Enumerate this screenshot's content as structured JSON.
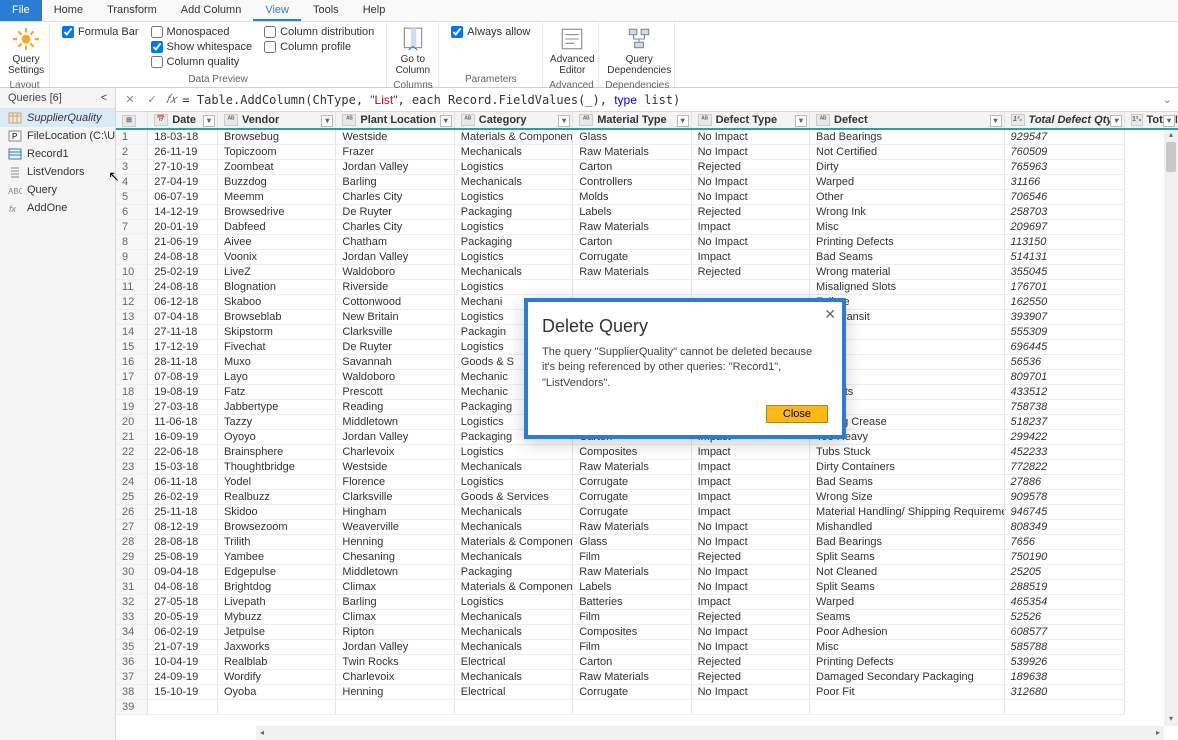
{
  "menubar": [
    "File",
    "Home",
    "Transform",
    "Add Column",
    "View",
    "Tools",
    "Help"
  ],
  "active_menu": "View",
  "ribbon": {
    "layout": {
      "query_settings": "Query\nSettings",
      "label": "Layout"
    },
    "data_preview": {
      "formula_bar": "Formula Bar",
      "monospaced": "Monospaced",
      "show_whitespace": "Show whitespace",
      "column_quality": "Column quality",
      "column_distribution": "Column distribution",
      "column_profile": "Column profile",
      "label": "Data Preview"
    },
    "goto": "Go to\nColumn",
    "columns_label": "Columns",
    "always_allow": "Always allow",
    "parameters_label": "Parameters",
    "adv_editor": "Advanced\nEditor",
    "advanced_label": "Advanced",
    "query_deps": "Query\nDependencies",
    "deps_label": "Dependencies"
  },
  "sidebar": {
    "title": "Queries [6]",
    "items": [
      {
        "name": "SupplierQuality",
        "icon": "table",
        "sel": true
      },
      {
        "name": "FileLocation (C:\\Users...",
        "icon": "param"
      },
      {
        "name": "Record1",
        "icon": "record"
      },
      {
        "name": "ListVendors",
        "icon": "list"
      },
      {
        "name": "Query",
        "icon": "abc"
      },
      {
        "name": "AddOne",
        "icon": "fx"
      }
    ]
  },
  "formula": {
    "prefix": "= Table.AddColumn(ChType, ",
    "str1": "\"List\"",
    "mid1": ", each Record.FieldValues(_), ",
    "kw": "type",
    "mid2": " list)"
  },
  "columns": [
    "",
    "Date",
    "Vendor",
    "Plant Location",
    "Category",
    "Material Type",
    "Defect Type",
    "Defect",
    "Total Defect Qty",
    "Total Dow"
  ],
  "col_types": [
    "",
    "date",
    "abc",
    "abc",
    "abc",
    "abc",
    "abc",
    "abc",
    "123",
    "123"
  ],
  "rows": [
    [
      "18-03-18",
      "Browsebug",
      "Westside",
      "Materials & Components",
      "Glass",
      "No Impact",
      "Bad Bearings",
      "929547"
    ],
    [
      "26-11-19",
      "Topiczoom",
      "Frazer",
      "Mechanicals",
      "Raw Materials",
      "No Impact",
      "Not Certified",
      "760509"
    ],
    [
      "27-10-19",
      "Zoombeat",
      "Jordan Valley",
      "Logistics",
      "Carton",
      "Rejected",
      "Dirty",
      "765963"
    ],
    [
      "27-04-19",
      "Buzzdog",
      "Barling",
      "Mechanicals",
      "Controllers",
      "No Impact",
      "Warped",
      "31166"
    ],
    [
      "06-07-19",
      "Meemm",
      "Charles City",
      "Logistics",
      "Molds",
      "No Impact",
      "Other",
      "706546"
    ],
    [
      "14-12-19",
      "Browsedrive",
      "De Ruyter",
      "Packaging",
      "Labels",
      "Rejected",
      "Wrong Ink",
      "258703"
    ],
    [
      "20-01-19",
      "Dabfeed",
      "Charles City",
      "Logistics",
      "Raw Materials",
      "Impact",
      "Misc",
      "209697"
    ],
    [
      "21-06-19",
      "Aivee",
      "Chatham",
      "Packaging",
      "Carton",
      "No Impact",
      "Printing Defects",
      "113150"
    ],
    [
      "24-08-18",
      "Voonix",
      "Jordan Valley",
      "Logistics",
      "Corrugate",
      "Impact",
      "Bad Seams",
      "514131"
    ],
    [
      "25-02-19",
      "LiveZ",
      "Waldoboro",
      "Mechanicals",
      "Raw Materials",
      "Rejected",
      "Wrong material",
      "355045"
    ],
    [
      "24-08-18",
      "Blognation",
      "Riverside",
      "Logistics",
      "",
      "",
      "Misaligned Slots",
      "176701"
    ],
    [
      "06-12-18",
      "Skaboo",
      "Cottonwood",
      "Mechani",
      "",
      "",
      "Failure",
      "162550"
    ],
    [
      "07-04-18",
      "Browseblab",
      "New Britain",
      "Logistics",
      "",
      "",
      "d in Transit",
      "393907"
    ],
    [
      "27-11-18",
      "Skipstorm",
      "Clarksville",
      "Packagin",
      "",
      "",
      "ation",
      "555309"
    ],
    [
      "17-12-19",
      "Fivechat",
      "De Ruyter",
      "Logistics",
      "",
      "",
      "ck",
      "696445"
    ],
    [
      "28-11-18",
      "Muxo",
      "Savannah",
      "Goods & S",
      "",
      "",
      "ms",
      "56536"
    ],
    [
      "07-08-19",
      "Layo",
      "Waldoboro",
      "Mechanic",
      "",
      "",
      "",
      "809701"
    ],
    [
      "19-08-19",
      "Fatz",
      "Prescott",
      "Mechanic",
      "",
      "",
      "Defects",
      "433512"
    ],
    [
      "27-03-18",
      "Jabbertype",
      "Reading",
      "Packaging",
      "",
      "",
      "ects",
      "758738"
    ],
    [
      "11-06-18",
      "Tazzy",
      "Middletown",
      "Logistics",
      "Corrugate",
      "Impact",
      "Wrong Crease",
      "518237"
    ],
    [
      "16-09-19",
      "Oyoyo",
      "Jordan Valley",
      "Packaging",
      "Carton",
      "Impact",
      "Too Heavy",
      "299422"
    ],
    [
      "22-06-18",
      "Brainsphere",
      "Charlevoix",
      "Logistics",
      "Composites",
      "Impact",
      "Tubs Stuck",
      "452233"
    ],
    [
      "15-03-18",
      "Thoughtbridge",
      "Westside",
      "Mechanicals",
      "Raw Materials",
      "Impact",
      "Dirty Containers",
      "772822"
    ],
    [
      "06-11-18",
      "Yodel",
      "Florence",
      "Logistics",
      "Corrugate",
      "Impact",
      "Bad Seams",
      "27886"
    ],
    [
      "26-02-19",
      "Realbuzz",
      "Clarksville",
      "Goods & Services",
      "Corrugate",
      "Impact",
      "Wrong  Size",
      "909578"
    ],
    [
      "25-11-18",
      "Skidoo",
      "Hingham",
      "Mechanicals",
      "Corrugate",
      "Impact",
      "Material Handling/ Shipping Requirements Error",
      "946745"
    ],
    [
      "08-12-19",
      "Browsezoom",
      "Weaverville",
      "Mechanicals",
      "Raw Materials",
      "No Impact",
      "Mishandled",
      "808349"
    ],
    [
      "28-08-18",
      "Trilith",
      "Henning",
      "Materials & Components",
      "Glass",
      "No Impact",
      "Bad Bearings",
      "7656"
    ],
    [
      "25-08-19",
      "Yambee",
      "Chesaning",
      "Mechanicals",
      "Film",
      "Rejected",
      "Split Seams",
      "750190"
    ],
    [
      "09-04-18",
      "Edgepulse",
      "Middletown",
      "Packaging",
      "Raw Materials",
      "No Impact",
      "Not Cleaned",
      "25205"
    ],
    [
      "04-08-18",
      "Brightdog",
      "Climax",
      "Materials & Components",
      "Labels",
      "No Impact",
      "Split Seams",
      "288519"
    ],
    [
      "27-05-18",
      "Livepath",
      "Barling",
      "Logistics",
      "Batteries",
      "Impact",
      "Warped",
      "465354"
    ],
    [
      "20-05-19",
      "Mybuzz",
      "Climax",
      "Mechanicals",
      "Film",
      "Rejected",
      "Seams",
      "52526"
    ],
    [
      "06-02-19",
      "Jetpulse",
      "Ripton",
      "Mechanicals",
      "Composites",
      "No Impact",
      "Poor  Adhesion",
      "608577"
    ],
    [
      "21-07-19",
      "Jaxworks",
      "Jordan Valley",
      "Mechanicals",
      "Film",
      "No Impact",
      "Misc",
      "585788"
    ],
    [
      "10-04-19",
      "Realblab",
      "Twin Rocks",
      "Electrical",
      "Carton",
      "Rejected",
      "Printing Defects",
      "539926"
    ],
    [
      "24-09-19",
      "Wordify",
      "Charlevoix",
      "Mechanicals",
      "Raw Materials",
      "Rejected",
      "Damaged Secondary Packaging",
      "189638"
    ],
    [
      "15-10-19",
      "Oyoba",
      "Henning",
      "Electrical",
      "Corrugate",
      "No Impact",
      "Poor Fit",
      "312680"
    ],
    [
      "",
      "",
      "",
      "",
      "",
      "",
      "",
      ""
    ]
  ],
  "dialog": {
    "title": "Delete Query",
    "body": "The query \"SupplierQuality\" cannot be deleted because it's being referenced by other queries: \"Record1\", \"ListVendors\".",
    "close": "Close"
  }
}
